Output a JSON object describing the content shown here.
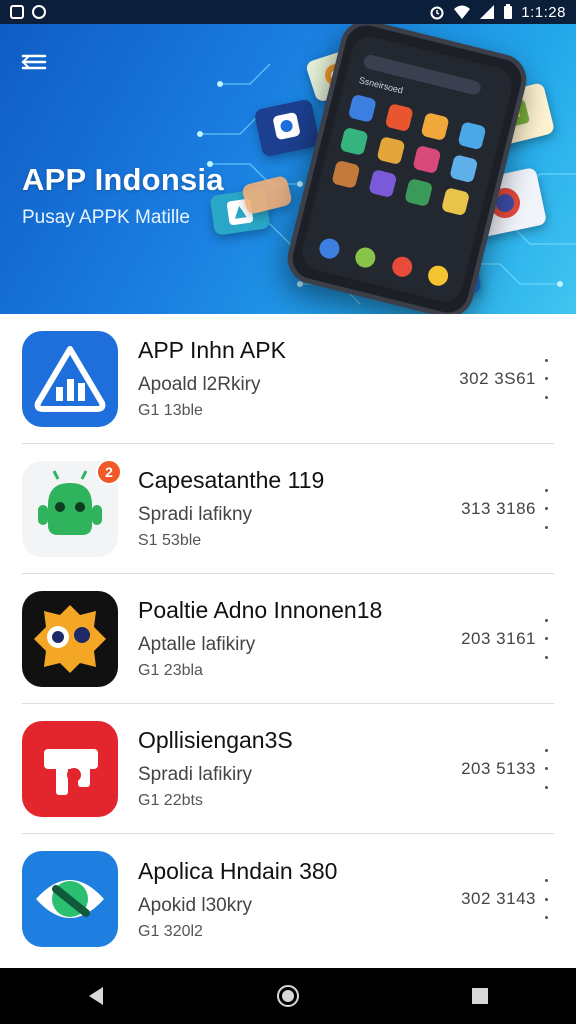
{
  "status_bar": {
    "time": "1:1:28",
    "icons": [
      "notification-icon",
      "app-icon",
      "alarm-icon",
      "wifi-icon",
      "signal-icon",
      "battery-icon"
    ]
  },
  "hero": {
    "title": "APP Indonsia",
    "subtitle": "Pusay APPK Matille",
    "phone_header": "Ssneirsoed"
  },
  "apps": [
    {
      "name": "APP Inhn APK",
      "developer": "Apoald l2Rkiry",
      "size": "G1 13ble",
      "count": "302 3S61",
      "icon": "triangle-chart-icon",
      "color": "#1e6fdc"
    },
    {
      "name": "Capesatanthe 119",
      "developer": "Spradi lafikny",
      "size": "S1 53ble",
      "count": "313 3186",
      "icon": "android-robot-icon",
      "color": "#ffffff",
      "badge": "2"
    },
    {
      "name": "Poaltie Adno Innonen18",
      "developer": "Aptalle lafikiry",
      "size": "G1 23bla",
      "count": "203 3161",
      "icon": "cartoon-face-icon",
      "color": "#111111"
    },
    {
      "name": "Opllisiengan3S",
      "developer": "Spradi lafikiry",
      "size": "G1 22bts",
      "count": "203 5133",
      "icon": "red-logo-icon",
      "color": "#e3262e"
    },
    {
      "name": "Apolica Hndain 380",
      "developer": "Apokid l30kry",
      "size": "G1 320l2",
      "count": "302 3143",
      "icon": "green-eye-icon",
      "color": "#1e7fe0"
    }
  ],
  "nav": {
    "back": "back-icon",
    "home": "home-icon",
    "recents": "recents-icon"
  }
}
